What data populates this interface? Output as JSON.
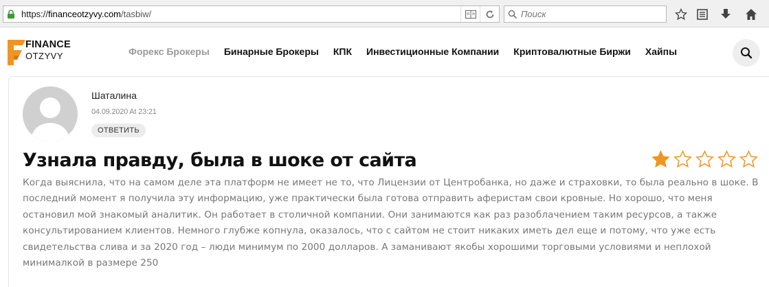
{
  "browser": {
    "url_scheme": "https://",
    "url_domain": "financeotzyvy.com",
    "url_path": "/tasbiw/",
    "search_placeholder": "Поиск"
  },
  "site": {
    "logo_top": "FINANCE",
    "logo_bottom": "OTZYVY",
    "brand_color": "#f29421",
    "nav": [
      {
        "label": "Форекс Брокеры",
        "active": true
      },
      {
        "label": "Бинарные Брокеры",
        "active": false
      },
      {
        "label": "КПК",
        "active": false
      },
      {
        "label": "Инвестиционные Компании",
        "active": false
      },
      {
        "label": "Криптовалютные Биржи",
        "active": false
      },
      {
        "label": "Хайпы",
        "active": false
      }
    ]
  },
  "review": {
    "author": "Шаталина",
    "date": "04.09.2020 At 23:21",
    "reply_label": "ОТВЕТИТЬ",
    "title": "Узнала правду, была в шоке от сайта",
    "rating": 1,
    "rating_max": 5,
    "star_color": "#f29421",
    "text": "Когда выяснила, что на самом деле эта платформ не имеет не то, что Лицензии от Центробанка, но даже и страховки, то была реально в шоке. В последний момент я получила эту информацию, уже практически была готова отправить аферистам свои кровные. Но хорошо, что меня остановил мой знакомый аналитик. Он работает в столичной компании. Они занимаются как раз разоблачением таким ресурсов, а также консультированием клиентов. Немного глубже копнула, оказалось, что с сайтом не стоит никаких иметь дел еще и потому, что уже есть свидетельства слива и за 2020 год – люди минимум по 2000 долларов. А заманивают якобы хорошими торговыми условиями и неплохой минималкой в размере 250"
  }
}
